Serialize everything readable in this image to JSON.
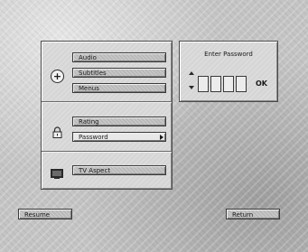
{
  "left_panel": {
    "audio_group": {
      "items": [
        {
          "label": "Audio"
        },
        {
          "label": "Subtitles"
        },
        {
          "label": "Menus"
        }
      ]
    },
    "lock_group": {
      "items": [
        {
          "label": "Rating"
        },
        {
          "label": "Password",
          "selected": true
        }
      ]
    },
    "display_group": {
      "items": [
        {
          "label": "TV Aspect"
        }
      ]
    }
  },
  "password_panel": {
    "title": "Enter Password",
    "digits": [
      "",
      "",
      "",
      ""
    ],
    "ok_label": "OK"
  },
  "bottom": {
    "resume_label": "Resume",
    "return_label": "Return"
  },
  "icons": {
    "audio_group": "plus-circle-icon",
    "lock_group": "lock-icon",
    "display_group": "monitor-icon"
  }
}
